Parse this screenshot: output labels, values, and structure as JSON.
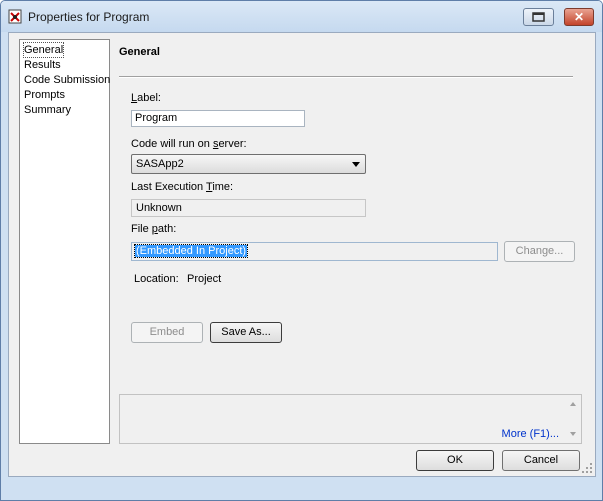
{
  "window": {
    "title": "Properties for Program",
    "restore_icon": "restore-icon",
    "close_glyph": "✕",
    "close_icon": "close-icon"
  },
  "sidebar": {
    "items": [
      {
        "label": "General",
        "selected": true
      },
      {
        "label": "Results"
      },
      {
        "label": "Code Submission"
      },
      {
        "label": "Prompts"
      },
      {
        "label": "Summary"
      }
    ]
  },
  "general": {
    "heading": "General",
    "label_field": {
      "label_key": "L",
      "label_rest": "abel:",
      "value": "Program"
    },
    "server": {
      "label_pre": "Code will run on ",
      "label_key": "s",
      "label_post": "erver:",
      "value": "SASApp2"
    },
    "last_exec": {
      "label_pre": "Last Execution ",
      "label_key": "T",
      "label_post": "ime:",
      "value": "Unknown"
    },
    "file_path": {
      "label_pre": "File ",
      "label_key": "p",
      "label_post": "ath:",
      "value": "(Embedded In Project)"
    },
    "change_button": "Change...",
    "location_label": "Location:",
    "location_value": "Project",
    "embed_button": "Embed",
    "save_as_button": "Save As..."
  },
  "help": {
    "more_link": "More (F1)..."
  },
  "footer": {
    "ok_button": "OK",
    "cancel_button": "Cancel"
  },
  "colors": {
    "titlebar": "#c5d9ef",
    "selection": "#3399ff",
    "link": "#0033cc",
    "close_button": "#c3432a"
  }
}
